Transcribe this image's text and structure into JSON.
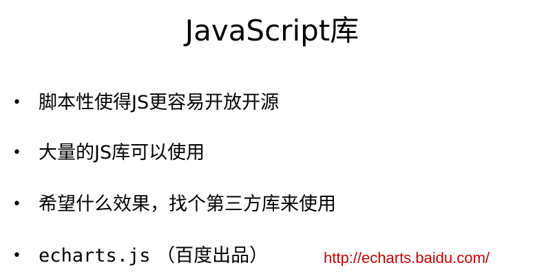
{
  "slide": {
    "title": "JavaScript库",
    "bullet_marker": "•",
    "bullets": [
      {
        "text": "脚本性使得JS更容易开放开源"
      },
      {
        "text": "大量的JS库可以使用"
      },
      {
        "text": "希望什么效果，找个第三方库来使用"
      },
      {
        "code": "echarts.js",
        "text": " （百度出品）"
      }
    ],
    "link": {
      "text": "http://echarts.baidu.com/"
    }
  },
  "colors": {
    "background": "#ffffff",
    "text": "#000000",
    "link": "#cc0000"
  }
}
